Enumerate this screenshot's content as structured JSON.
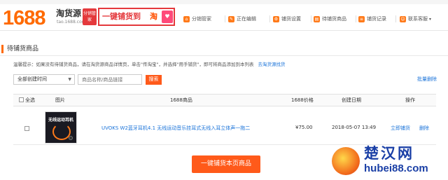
{
  "header": {
    "logo_number": "1688",
    "logo_cn": "淘货源",
    "logo_sub": "tao.1688.com",
    "badge": "分销管家",
    "promo_text": "一键铺货到",
    "promo_tao": "淘",
    "nav": [
      {
        "label": "分销管家",
        "icon": "distribution-icon"
      },
      {
        "label": "正在编辑",
        "icon": "edit-icon"
      },
      {
        "label": "铺货设置",
        "icon": "settings-icon"
      },
      {
        "label": "待铺货商品",
        "icon": "pending-goods-icon"
      },
      {
        "label": "铺货记录",
        "icon": "record-icon"
      },
      {
        "label": "联系客服",
        "icon": "service-icon"
      }
    ]
  },
  "section": {
    "title": "待铺货商品"
  },
  "tip": {
    "text": "温馨提示：如果没有待铺货商品，请在淘货源商品详情页，单击\"传淘宝\"，并选择\"用手铺货\"，即可将商品添加到本列表",
    "link": "去淘货源找货"
  },
  "filters": {
    "time_select": "全部创建时间",
    "search_placeholder": "商品名称/商品链接",
    "search_button": "搜索",
    "batch_delete": "批量删除"
  },
  "table": {
    "headers": {
      "select_all": "全选",
      "image": "图片",
      "product": "1688商品",
      "price": "1688价格",
      "date": "创建日期",
      "ops": "操作"
    },
    "rows": [
      {
        "thumb_text": "无线运动耳机",
        "title": "UVOKS W2蓝牙耳机4.1 无线运动音乐挂耳式无线入耳立体声一拖二",
        "price": "¥75.00",
        "date": "2018-05-07 13:49",
        "op_publish": "立即铺货",
        "op_delete": "删除"
      }
    ]
  },
  "actions": {
    "publish_page": "一键铺货本页商品"
  },
  "watermark": {
    "main": "楚汉网",
    "url": "hubei88.com"
  },
  "colors": {
    "accent": "#ff6a00",
    "link": "#1a73d9",
    "button": "#ff5a1a"
  }
}
